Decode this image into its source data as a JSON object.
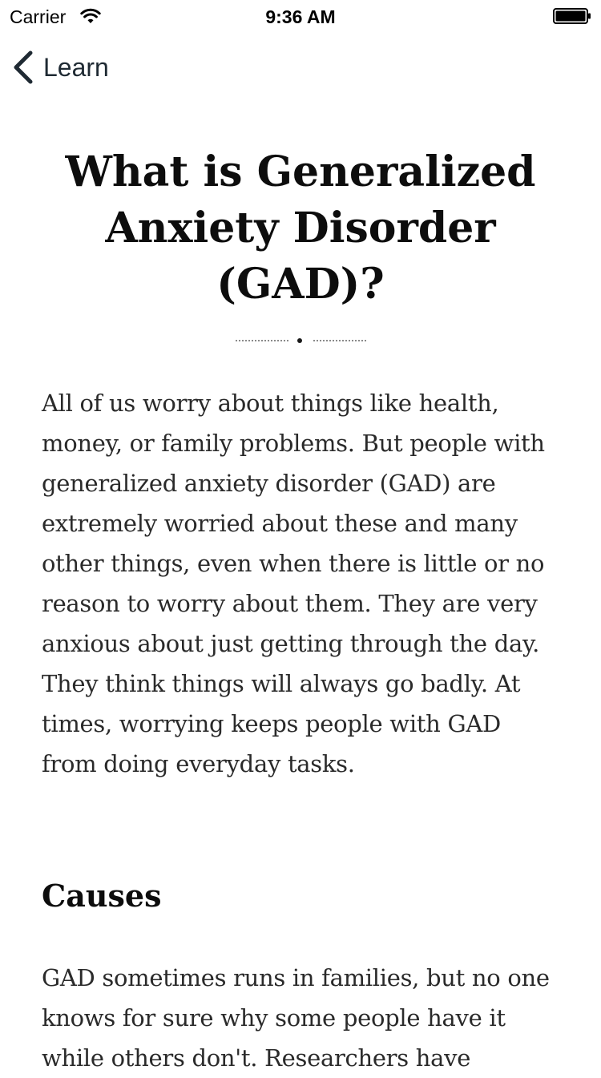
{
  "status_bar": {
    "carrier": "Carrier",
    "time": "9:36 AM",
    "wifi_icon": "wifi-icon",
    "battery_icon": "battery-full-icon"
  },
  "nav": {
    "back_label": "Learn",
    "back_icon": "chevron-left-icon"
  },
  "article": {
    "title": "What is Generalized Anxiety Disorder (GAD)?",
    "intro": "All of us worry about things like health, money, or family problems. But people with generalized anxiety disorder (GAD) are extremely worried about these and many other things, even when there is little or no reason to worry about them. They are very anxious about just getting through the day. They think things will always go badly. At times, worrying keeps people with GAD from doing everyday tasks.",
    "sections": [
      {
        "heading": "Causes",
        "body": "GAD sometimes runs in families, but no one knows for sure why some people have it while others don't. Researchers have"
      }
    ]
  },
  "colors": {
    "background": "#ffffff",
    "text": "#2a2a2a",
    "heading": "#0d0d0d",
    "nav_tint": "#1f2a33"
  }
}
